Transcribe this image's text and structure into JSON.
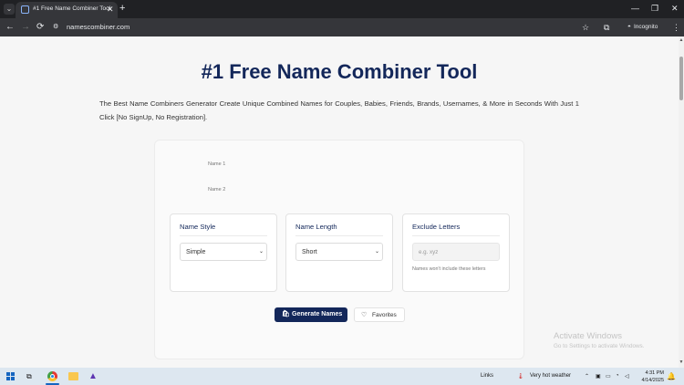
{
  "browser": {
    "tab_title": "#1 Free Name Combiner Tool",
    "tab_close": "✕",
    "new_tab": "+",
    "tab_menu": "⌄",
    "url": "namescombiner.com",
    "incognito_label": "Incognito",
    "window_controls": {
      "minimize": "—",
      "restore": "❐",
      "close": "✕"
    },
    "nav": {
      "back": "←",
      "forward": "→",
      "reload": "⟳"
    },
    "icons": {
      "site_info": "site-info-icon",
      "star": "star-icon",
      "extensions": "puzzle-icon",
      "menu": "menu-dots-icon"
    }
  },
  "page": {
    "title": "#1 Free Name Combiner Tool",
    "description": "The Best Name Combiners Generator Create Unique Combined Names for Couples, Babies, Friends, Brands, Usernames, & More in Seconds With Just 1 Click [No SignUp, No Registration].",
    "form": {
      "name1_label": "Name 1",
      "name1_value": "",
      "name2_label": "Name 2",
      "name2_value": "",
      "name_style": {
        "title": "Name Style",
        "selected": "Simple"
      },
      "name_length": {
        "title": "Name Length",
        "selected": "Short"
      },
      "exclude_letters": {
        "title": "Exclude Letters",
        "placeholder": "e.g. xyz",
        "hint": "Names won't include these letters"
      },
      "generate_label": "Generate Names",
      "favorites_label": "Favorites"
    },
    "watermark": {
      "line1": "Activate Windows",
      "line2": "Go to Settings to activate Windows."
    }
  },
  "taskbar": {
    "links_label": "Links",
    "weather": "Very hot weather",
    "time": "4:31 PM",
    "date": "4/14/2025"
  },
  "colors": {
    "brand_navy": "#13275a",
    "page_bg": "#f6f6f6",
    "chrome_dark": "#202124",
    "taskbar": "#dde7f0"
  }
}
